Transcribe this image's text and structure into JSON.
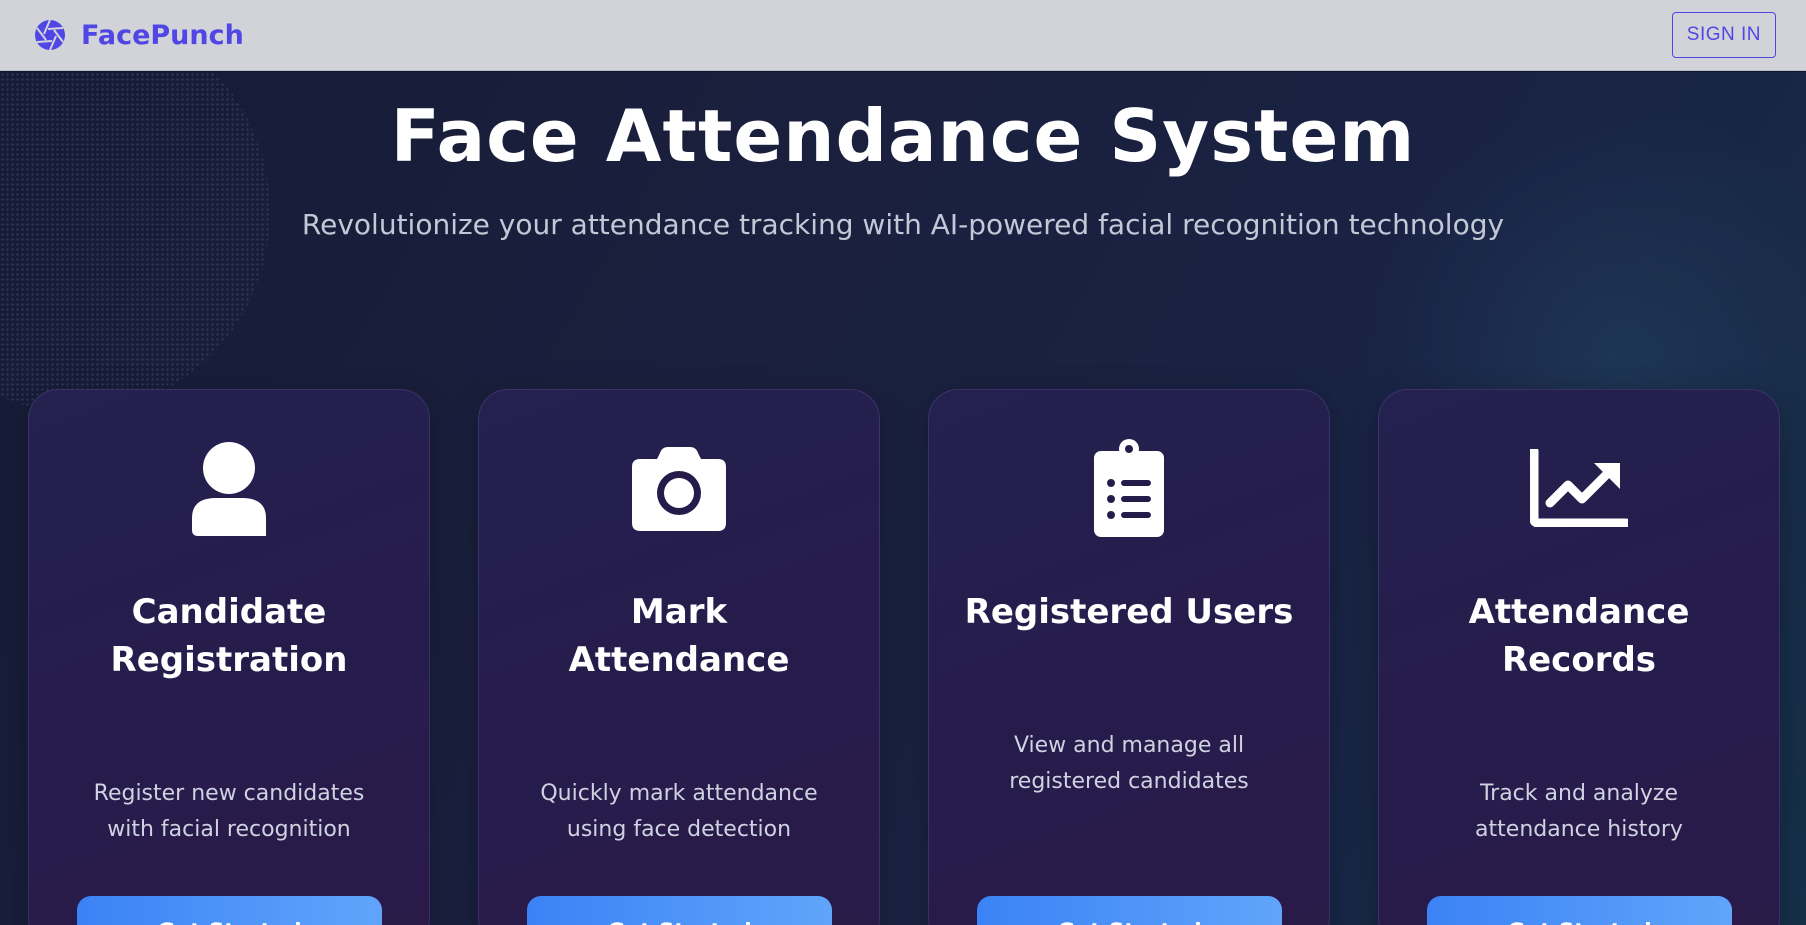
{
  "header": {
    "brand_name": "FacePunch",
    "brand_icon": "camera-aperture-icon",
    "signin_label": "SIGN IN"
  },
  "hero": {
    "title": "Face Attendance System",
    "subtitle": "Revolutionize your attendance tracking with AI-powered facial recognition technology"
  },
  "cards": [
    {
      "icon": "user-icon",
      "title_line1": "Candidate",
      "title_line2": "Registration",
      "desc_line1": "Register new candidates",
      "desc_line2": "with facial recognition",
      "button_label": "Get Started"
    },
    {
      "icon": "camera-icon",
      "title_line1": "Mark",
      "title_line2": "Attendance",
      "desc_line1": "Quickly mark attendance",
      "desc_line2": "using face detection",
      "button_label": "Get Started"
    },
    {
      "icon": "clipboard-list-icon",
      "title_line1": "Registered Users",
      "desc_line1": "View and manage all",
      "desc_line2": "registered candidates",
      "button_label": "Get Started"
    },
    {
      "icon": "chart-line-icon",
      "title_line1": "Attendance",
      "title_line2": "Records",
      "desc_line1": "Track and analyze",
      "desc_line2": "attendance history",
      "button_label": "Get Started"
    }
  ],
  "colors": {
    "brand": "#4f46e5",
    "header_bg": "#d1d3d9",
    "button_start": "#3b82f6",
    "button_end": "#60a5fa",
    "card_bg": "#261c4c"
  }
}
